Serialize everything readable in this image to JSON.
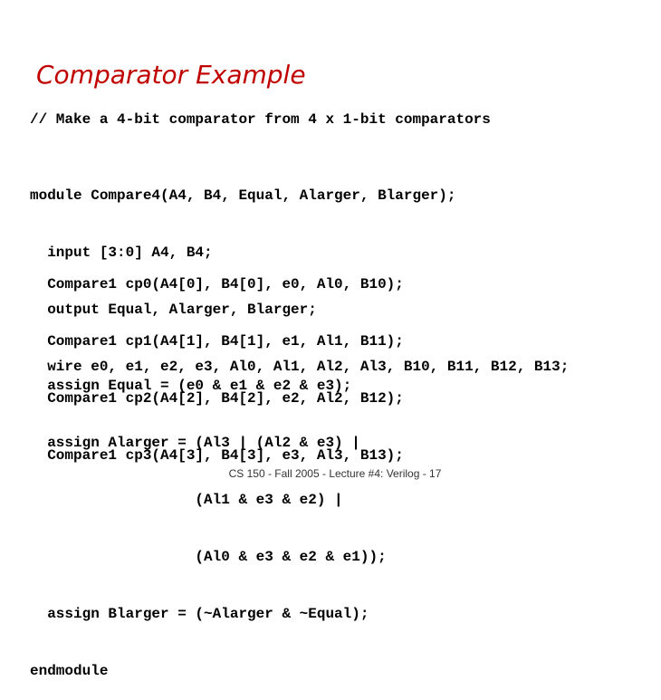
{
  "slide": {
    "title": "Comparator Example",
    "title_color": "#c00000",
    "comment": "// Make a 4-bit comparator from 4 x 1-bit comparators",
    "header_lines": [
      "module Compare4(A4, B4, Equal, Alarger, Blarger);",
      "  input [3:0] A4, B4;",
      "  output Equal, Alarger, Blarger;",
      "  wire e0, e1, e2, e3, Al0, Al1, Al2, Al3, B10, B11, B12, B13;"
    ],
    "instance_lines": [
      "  Compare1 cp0(A4[0], B4[0], e0, Al0, B10);",
      "  Compare1 cp1(A4[1], B4[1], e1, Al1, B11);",
      "  Compare1 cp2(A4[2], B4[2], e2, Al2, B12);",
      "  Compare1 cp3(A4[3], B4[3], e3, Al3, B13);"
    ],
    "assign_lines": [
      "  assign Equal = (e0 & e1 & e2 & e3);",
      "  assign Alarger = (Al3 | (Al2 & e3) |",
      "                   (Al1 & e3 & e2) |",
      "                   (Al0 & e3 & e2 & e1));",
      "  assign Blarger = (~Alarger & ~Equal);",
      "endmodule"
    ],
    "footer": "CS 150 - Fall 2005 - Lecture #4: Verilog - 17"
  }
}
